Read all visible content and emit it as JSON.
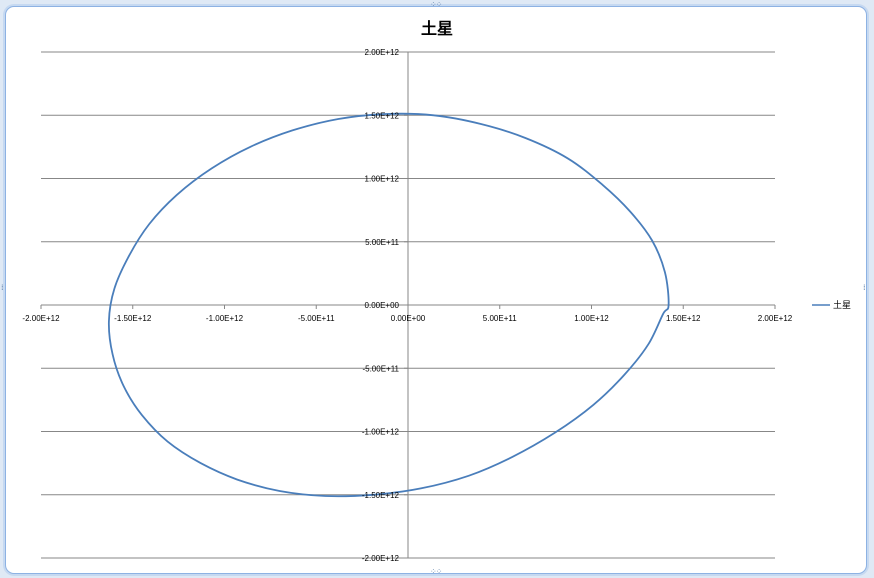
{
  "chart_data": {
    "type": "scatter",
    "title": "土星",
    "xlabel": "",
    "ylabel": "",
    "xlim": [
      -2000000000000.0,
      2000000000000.0
    ],
    "ylim": [
      -2000000000000.0,
      2000000000000.0
    ],
    "x_ticks": [
      "-2.00E+12",
      "-1.50E+12",
      "-1.00E+12",
      "-5.00E+11",
      "0.00E+00",
      "5.00E+11",
      "1.00E+12",
      "1.50E+12",
      "2.00E+12"
    ],
    "y_ticks": [
      "2.00E+12",
      "1.50E+12",
      "1.00E+12",
      "5.00E+11",
      "0.00E+00",
      "-5.00E+11",
      "-1.00E+12",
      "-1.50E+12",
      "-2.00E+12"
    ],
    "grid": true,
    "legend_position": "right",
    "series": [
      {
        "name": "土星",
        "color": "#4a7ebb",
        "x": [
          1420000000000.0,
          1400000000000.0,
          1330000000000.0,
          1210000000000.0,
          1060000000000.0,
          870000000000.0,
          640000000000.0,
          400000000000.0,
          140000000000.0,
          -120000000000.0,
          -380000000000.0,
          -630000000000.0,
          -860000000000.0,
          -1070000000000.0,
          -1260000000000.0,
          -1410000000000.0,
          -1520000000000.0,
          -1600000000000.0,
          -1630000000000.0,
          -1610000000000.0,
          -1550000000000.0,
          -1450000000000.0,
          -1310000000000.0,
          -1130000000000.0,
          -930000000000.0,
          -700000000000.0,
          -450000000000.0,
          -190000000000.0,
          70000000000.0,
          330000000000.0,
          570000000000.0,
          800000000000.0,
          1010000000000.0,
          1180000000000.0,
          1310000000000.0,
          1390000000000.0,
          1420000000000.0
        ],
        "y": [
          0.0,
          260000000000.0,
          510000000000.0,
          740000000000.0,
          950000000000.0,
          1160000000000.0,
          1320000000000.0,
          1430000000000.0,
          1500000000000.0,
          1510000000000.0,
          1470000000000.0,
          1380000000000.0,
          1250000000000.0,
          1080000000000.0,
          870000000000.0,
          640000000000.0,
          390000000000.0,
          130000000000.0,
          -130000000000.0,
          -390000000000.0,
          -640000000000.0,
          -870000000000.0,
          -1080000000000.0,
          -1250000000000.0,
          -1380000000000.0,
          -1470000000000.0,
          -1510000000000.0,
          -1500000000000.0,
          -1450000000000.0,
          -1350000000000.0,
          -1200000000000.0,
          -1010000000000.0,
          -790000000000.0,
          -550000000000.0,
          -310000000000.0,
          -70000000000.0,
          0.0
        ]
      }
    ]
  }
}
